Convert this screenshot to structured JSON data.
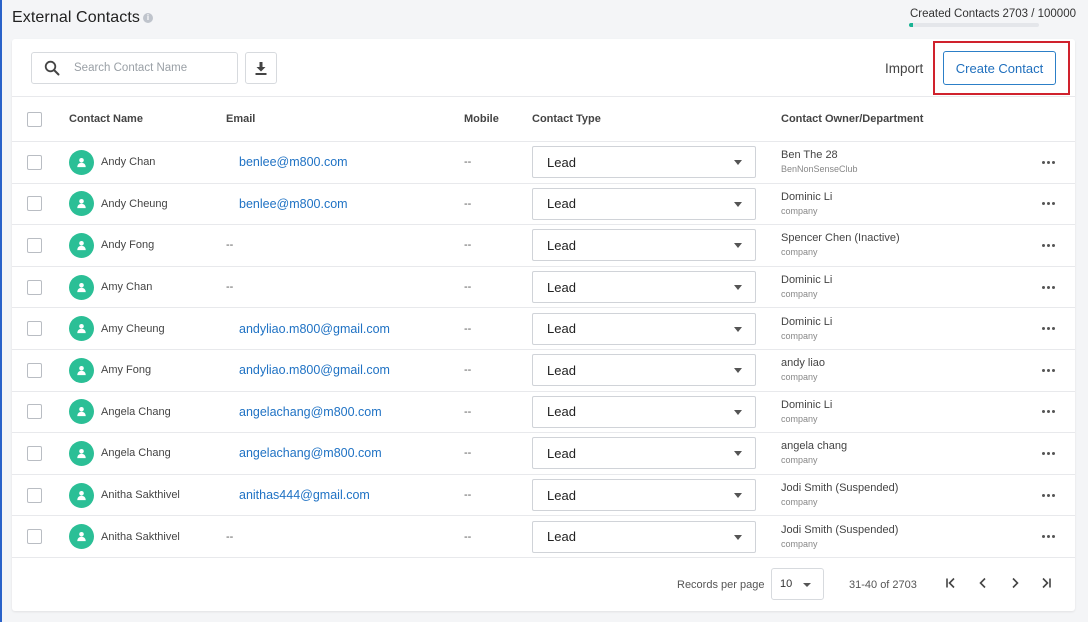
{
  "page": {
    "title": "External Contacts",
    "info_icon": "info-icon",
    "quota_label": "Created Contacts",
    "quota_value": "2703 / 100000",
    "quota_fraction": 0.027
  },
  "toolbar": {
    "search_placeholder": "Search Contact Name",
    "search_value": "",
    "download_icon": "download-icon",
    "import_label": "Import",
    "create_label": "Create Contact"
  },
  "colors": {
    "accent": "#1f72c4",
    "avatar": "#2bbf96",
    "highlight": "#d0222d",
    "quota_fill": "#1ab394"
  },
  "table": {
    "headers": {
      "name": "Contact Name",
      "email": "Email",
      "mobile": "Mobile",
      "type": "Contact Type",
      "owner": "Contact Owner/Department"
    },
    "rows": [
      {
        "name": "Andy Chan",
        "email": "benlee@m800.com",
        "mobile": "--",
        "type": "Lead",
        "owner": "Ben The 28",
        "dept": "BenNonSenseClub"
      },
      {
        "name": "Andy Cheung",
        "email": "benlee@m800.com",
        "mobile": "--",
        "type": "Lead",
        "owner": "Dominic Li",
        "dept": "company"
      },
      {
        "name": "Andy Fong",
        "email": "--",
        "mobile": "--",
        "type": "Lead",
        "owner": "Spencer Chen (Inactive)",
        "dept": "company"
      },
      {
        "name": "Amy Chan",
        "email": "--",
        "mobile": "--",
        "type": "Lead",
        "owner": "Dominic Li",
        "dept": "company"
      },
      {
        "name": "Amy Cheung",
        "email": "andyliao.m800@gmail.com",
        "mobile": "--",
        "type": "Lead",
        "owner": "Dominic Li",
        "dept": "company"
      },
      {
        "name": "Amy Fong",
        "email": "andyliao.m800@gmail.com",
        "mobile": "--",
        "type": "Lead",
        "owner": "andy liao",
        "dept": "company"
      },
      {
        "name": "Angela Chang",
        "email": "angelachang@m800.com",
        "mobile": "--",
        "type": "Lead",
        "owner": "Dominic Li",
        "dept": "company"
      },
      {
        "name": "Angela Chang",
        "email": "angelachang@m800.com",
        "mobile": "--",
        "type": "Lead",
        "owner": "angela chang",
        "dept": "company"
      },
      {
        "name": "Anitha Sakthivel",
        "email": "anithas444@gmail.com",
        "mobile": "--",
        "type": "Lead",
        "owner": "Jodi Smith (Suspended)",
        "dept": "company"
      },
      {
        "name": "Anitha Sakthivel",
        "email": "--",
        "mobile": "--",
        "type": "Lead",
        "owner": "Jodi Smith (Suspended)",
        "dept": "company"
      }
    ]
  },
  "pagination": {
    "records_label": "Records per page",
    "records_value": "10",
    "range": "31-40 of 2703"
  }
}
